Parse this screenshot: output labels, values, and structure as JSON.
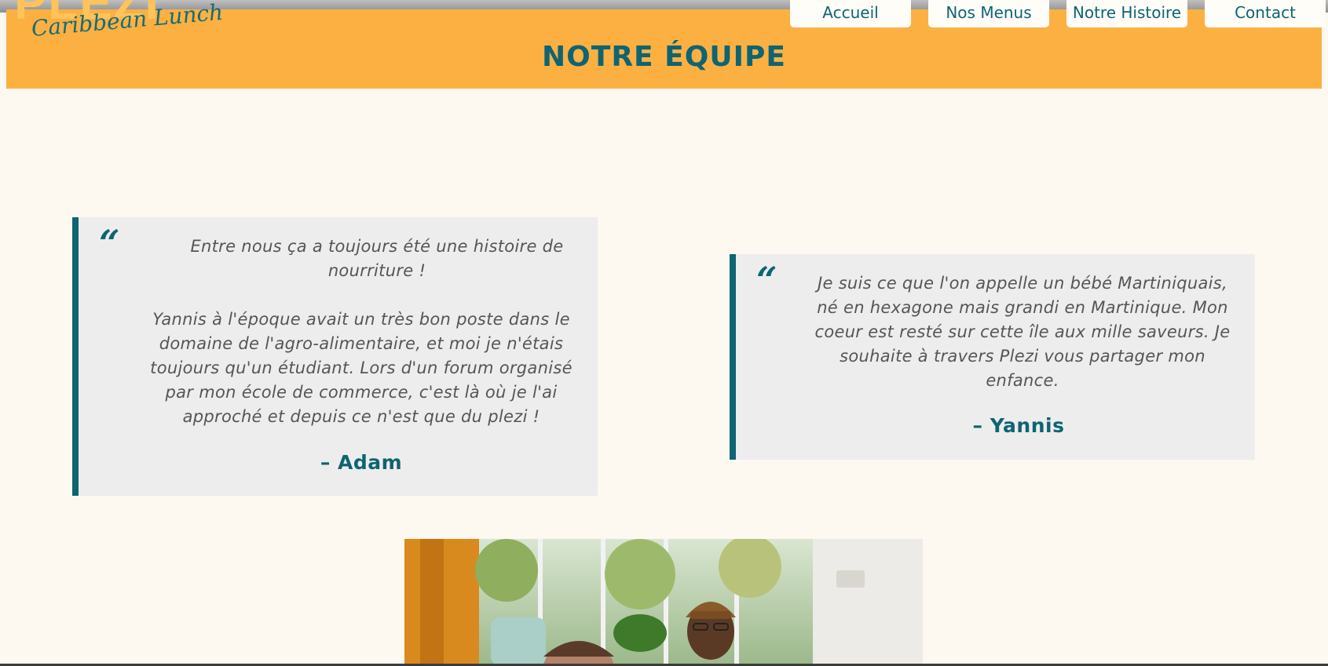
{
  "brand": {
    "logo_text": "PLEZI",
    "tagline": "Caribbean Lunch"
  },
  "nav": {
    "items": [
      {
        "label": "Accueil"
      },
      {
        "label": "Nos Menus"
      },
      {
        "label": "Notre Histoire"
      },
      {
        "label": "Contact"
      }
    ]
  },
  "page": {
    "title": "NOTRE ÉQUIPE"
  },
  "quotes": [
    {
      "mark": "“",
      "paragraph1": "Entre nous ça a toujours été une histoire de nourriture !",
      "paragraph2": "Yannis à l'époque avait un très bon poste dans le domaine de l'agro-alimentaire, et moi je n'étais toujours qu'un étudiant. Lors d'un forum organisé par mon école de commerce, c'est là où je l'ai approché et depuis ce n'est que du plezi !",
      "author": "– Adam"
    },
    {
      "mark": "“",
      "paragraph1": "Je suis ce que l'on appelle un bébé Martiniquais, né en hexagone mais grandi en Martinique. Mon coeur est resté sur cette île aux mille saveurs. Je souhaite à travers Plezi vous partager mon enfance.",
      "author": "– Yannis"
    }
  ],
  "colors": {
    "accent": "#FCB042",
    "brand_teal": "#0E6472",
    "background": "#FDF8F0",
    "quote_bg": "#EDEDED"
  }
}
